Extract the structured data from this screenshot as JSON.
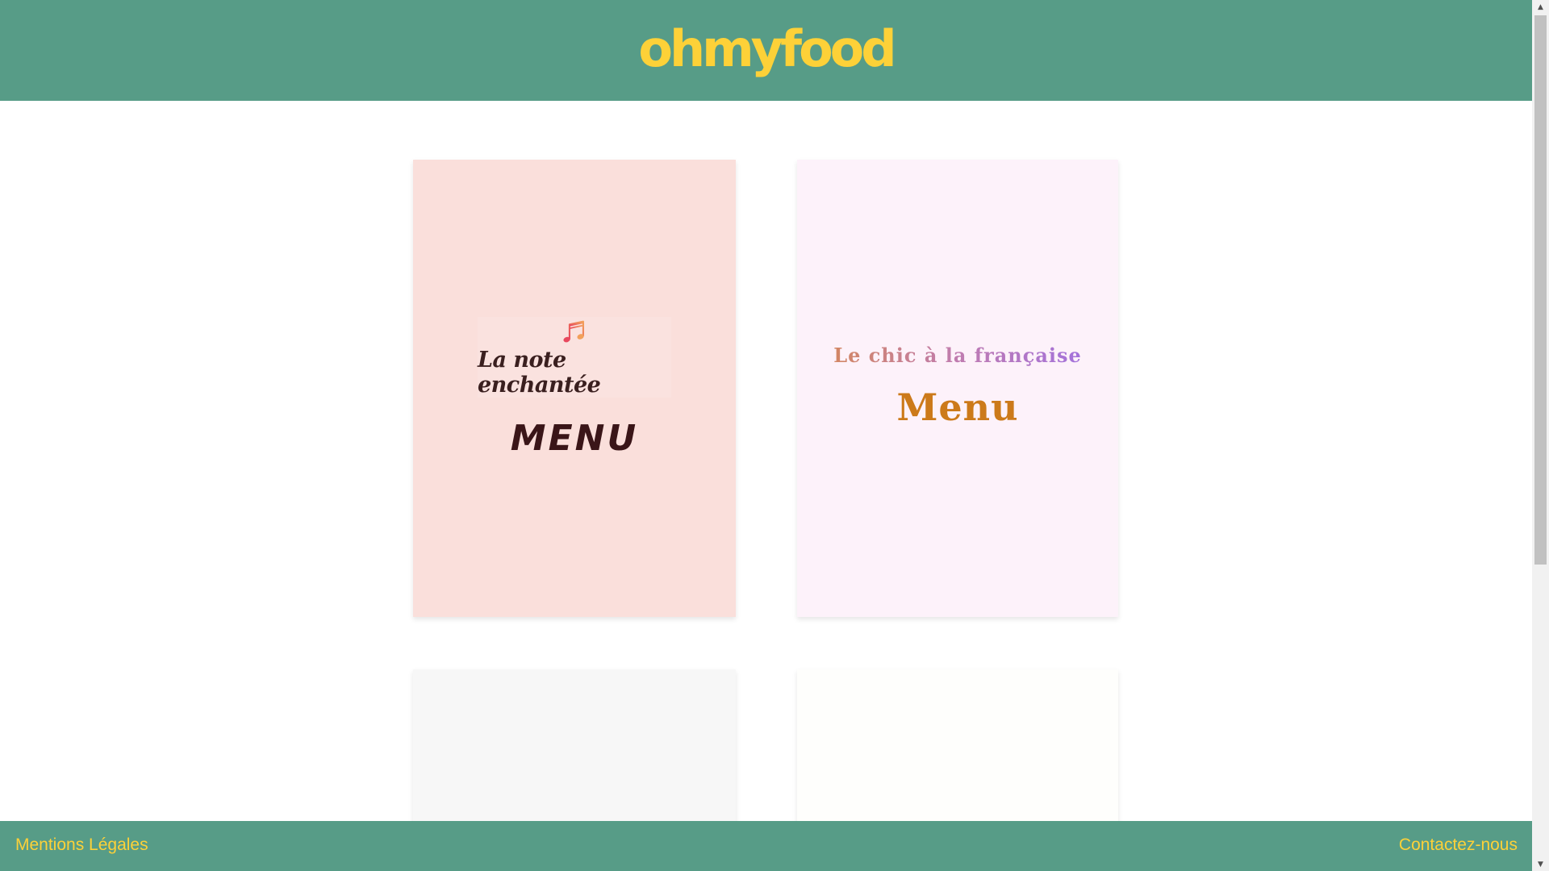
{
  "header": {
    "logo_text": "ohmyfood"
  },
  "cards": [
    {
      "restaurant_title": "La note enchantée",
      "menu_label": "MENU",
      "icon": "music-notes-icon",
      "background": "#fadfdb"
    },
    {
      "restaurant_title": "Le chic à la française",
      "menu_label": "Menu",
      "background": "#fdf2fa"
    },
    {
      "background": "#f7f7f7"
    },
    {
      "background": "#fefefc"
    }
  ],
  "footer": {
    "legal_link": "Mentions Légales",
    "contact_link": "Contactez-nous"
  },
  "colors": {
    "brand_green": "#579c87",
    "brand_yellow": "#fdd138"
  }
}
